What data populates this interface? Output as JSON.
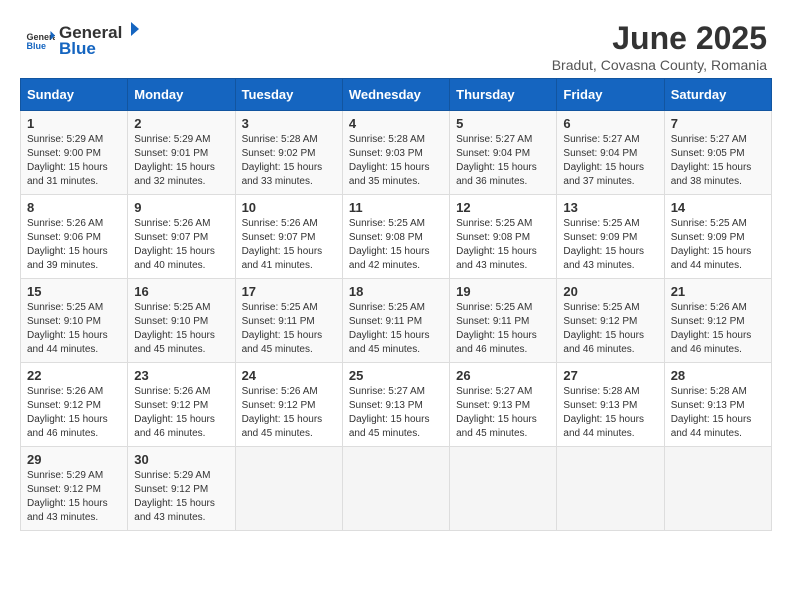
{
  "header": {
    "logo_general": "General",
    "logo_blue": "Blue",
    "month": "June 2025",
    "location": "Bradut, Covasna County, Romania"
  },
  "weekdays": [
    "Sunday",
    "Monday",
    "Tuesday",
    "Wednesday",
    "Thursday",
    "Friday",
    "Saturday"
  ],
  "weeks": [
    [
      {
        "day": "1",
        "info": "Sunrise: 5:29 AM\nSunset: 9:00 PM\nDaylight: 15 hours\nand 31 minutes."
      },
      {
        "day": "2",
        "info": "Sunrise: 5:29 AM\nSunset: 9:01 PM\nDaylight: 15 hours\nand 32 minutes."
      },
      {
        "day": "3",
        "info": "Sunrise: 5:28 AM\nSunset: 9:02 PM\nDaylight: 15 hours\nand 33 minutes."
      },
      {
        "day": "4",
        "info": "Sunrise: 5:28 AM\nSunset: 9:03 PM\nDaylight: 15 hours\nand 35 minutes."
      },
      {
        "day": "5",
        "info": "Sunrise: 5:27 AM\nSunset: 9:04 PM\nDaylight: 15 hours\nand 36 minutes."
      },
      {
        "day": "6",
        "info": "Sunrise: 5:27 AM\nSunset: 9:04 PM\nDaylight: 15 hours\nand 37 minutes."
      },
      {
        "day": "7",
        "info": "Sunrise: 5:27 AM\nSunset: 9:05 PM\nDaylight: 15 hours\nand 38 minutes."
      }
    ],
    [
      {
        "day": "8",
        "info": "Sunrise: 5:26 AM\nSunset: 9:06 PM\nDaylight: 15 hours\nand 39 minutes."
      },
      {
        "day": "9",
        "info": "Sunrise: 5:26 AM\nSunset: 9:07 PM\nDaylight: 15 hours\nand 40 minutes."
      },
      {
        "day": "10",
        "info": "Sunrise: 5:26 AM\nSunset: 9:07 PM\nDaylight: 15 hours\nand 41 minutes."
      },
      {
        "day": "11",
        "info": "Sunrise: 5:25 AM\nSunset: 9:08 PM\nDaylight: 15 hours\nand 42 minutes."
      },
      {
        "day": "12",
        "info": "Sunrise: 5:25 AM\nSunset: 9:08 PM\nDaylight: 15 hours\nand 43 minutes."
      },
      {
        "day": "13",
        "info": "Sunrise: 5:25 AM\nSunset: 9:09 PM\nDaylight: 15 hours\nand 43 minutes."
      },
      {
        "day": "14",
        "info": "Sunrise: 5:25 AM\nSunset: 9:09 PM\nDaylight: 15 hours\nand 44 minutes."
      }
    ],
    [
      {
        "day": "15",
        "info": "Sunrise: 5:25 AM\nSunset: 9:10 PM\nDaylight: 15 hours\nand 44 minutes."
      },
      {
        "day": "16",
        "info": "Sunrise: 5:25 AM\nSunset: 9:10 PM\nDaylight: 15 hours\nand 45 minutes."
      },
      {
        "day": "17",
        "info": "Sunrise: 5:25 AM\nSunset: 9:11 PM\nDaylight: 15 hours\nand 45 minutes."
      },
      {
        "day": "18",
        "info": "Sunrise: 5:25 AM\nSunset: 9:11 PM\nDaylight: 15 hours\nand 45 minutes."
      },
      {
        "day": "19",
        "info": "Sunrise: 5:25 AM\nSunset: 9:11 PM\nDaylight: 15 hours\nand 46 minutes."
      },
      {
        "day": "20",
        "info": "Sunrise: 5:25 AM\nSunset: 9:12 PM\nDaylight: 15 hours\nand 46 minutes."
      },
      {
        "day": "21",
        "info": "Sunrise: 5:26 AM\nSunset: 9:12 PM\nDaylight: 15 hours\nand 46 minutes."
      }
    ],
    [
      {
        "day": "22",
        "info": "Sunrise: 5:26 AM\nSunset: 9:12 PM\nDaylight: 15 hours\nand 46 minutes."
      },
      {
        "day": "23",
        "info": "Sunrise: 5:26 AM\nSunset: 9:12 PM\nDaylight: 15 hours\nand 46 minutes."
      },
      {
        "day": "24",
        "info": "Sunrise: 5:26 AM\nSunset: 9:12 PM\nDaylight: 15 hours\nand 45 minutes."
      },
      {
        "day": "25",
        "info": "Sunrise: 5:27 AM\nSunset: 9:13 PM\nDaylight: 15 hours\nand 45 minutes."
      },
      {
        "day": "26",
        "info": "Sunrise: 5:27 AM\nSunset: 9:13 PM\nDaylight: 15 hours\nand 45 minutes."
      },
      {
        "day": "27",
        "info": "Sunrise: 5:28 AM\nSunset: 9:13 PM\nDaylight: 15 hours\nand 44 minutes."
      },
      {
        "day": "28",
        "info": "Sunrise: 5:28 AM\nSunset: 9:13 PM\nDaylight: 15 hours\nand 44 minutes."
      }
    ],
    [
      {
        "day": "29",
        "info": "Sunrise: 5:29 AM\nSunset: 9:12 PM\nDaylight: 15 hours\nand 43 minutes."
      },
      {
        "day": "30",
        "info": "Sunrise: 5:29 AM\nSunset: 9:12 PM\nDaylight: 15 hours\nand 43 minutes."
      },
      {
        "day": "",
        "info": ""
      },
      {
        "day": "",
        "info": ""
      },
      {
        "day": "",
        "info": ""
      },
      {
        "day": "",
        "info": ""
      },
      {
        "day": "",
        "info": ""
      }
    ]
  ]
}
